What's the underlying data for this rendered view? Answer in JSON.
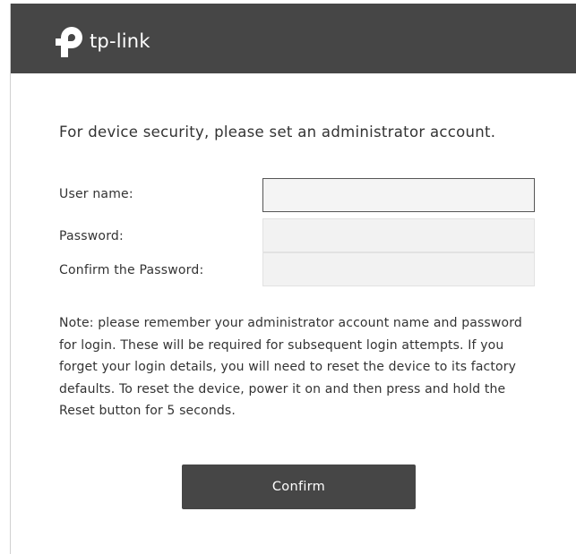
{
  "header": {
    "brand_text": "tp-link",
    "logo_icon": "tp-link-logo-icon",
    "background_color": "#464646"
  },
  "form": {
    "intro_text": "For device security, please set an administrator account.",
    "fields": [
      {
        "label": "User name:",
        "value": "",
        "placeholder": ""
      },
      {
        "label": "Password:",
        "value": "",
        "placeholder": ""
      },
      {
        "label": "Confirm the Password:",
        "value": "",
        "placeholder": ""
      }
    ],
    "note": "Note: please remember your administrator account name and password for login. These will be required for subsequent login attempts. If you forget your login details, you will need to reset the device to its factory defaults. To reset the device, power it on and then press and hold the Reset button for 5 seconds.",
    "confirm_label": "Confirm"
  },
  "colors": {
    "primary": "#464646",
    "text": "#333333",
    "input_background": "#f2f2f2"
  }
}
